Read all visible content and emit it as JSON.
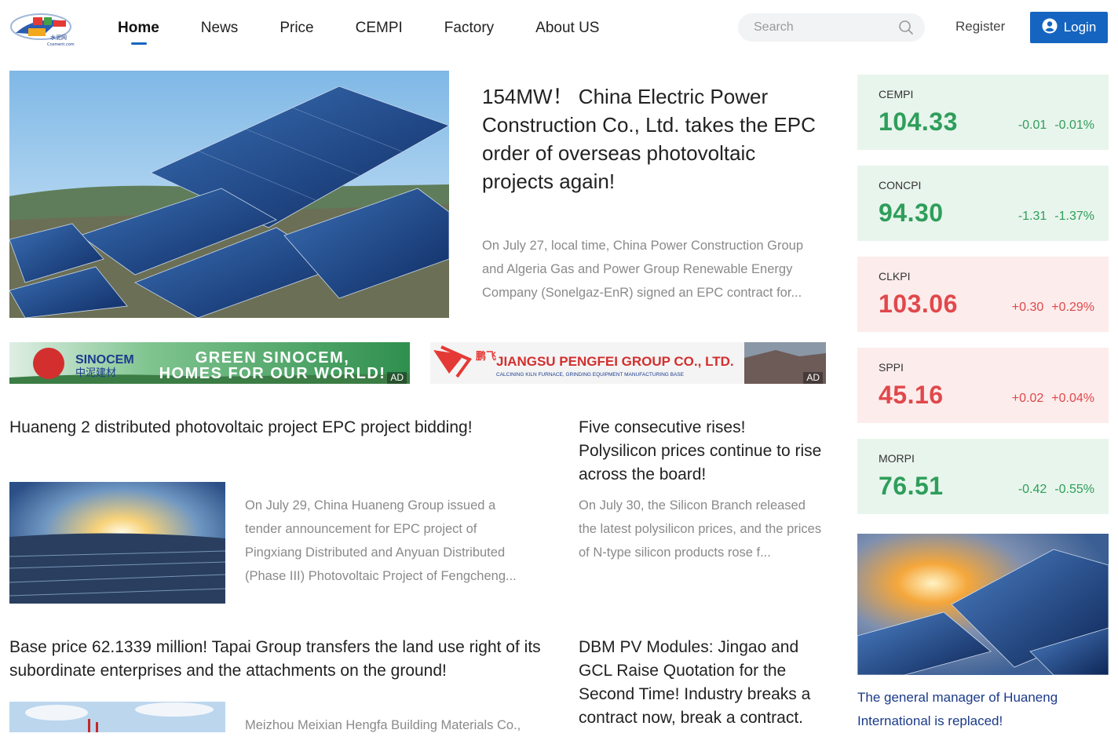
{
  "header": {
    "logo_caption": "水泥网",
    "logo_subcaption": "Ccement.com",
    "nav": [
      "Home",
      "News",
      "Price",
      "CEMPI",
      "Factory",
      "About US"
    ],
    "search_placeholder": "Search",
    "register_label": "Register",
    "login_label": "Login"
  },
  "hero": {
    "title": "154MW！ China Electric Power Construction Co., Ltd. takes the EPC order of overseas photovoltaic projects again!",
    "summary": "On July 27, local time, China Power Construction Group and Algeria Gas and Power Group Renewable Energy Company (Sonelgaz-EnR) signed an EPC contract for..."
  },
  "ads": [
    {
      "brand": "SINOCEM",
      "brand_cn": "中泥建材",
      "line1": "GREEN SINOCEM,",
      "line2": "HOMES FOR OUR WORLD!",
      "tag": "AD"
    },
    {
      "brand_cn": "鹏飞",
      "name": "JIANGSU PENGFEI GROUP CO., LTD.",
      "sub": "CALCINING KILN FURNACE, GRINDING EQUIPMENT MANUFACTURING BASE",
      "tag": "AD"
    }
  ],
  "articles": [
    {
      "title": "Huaneng 2 distributed photovoltaic project EPC project bidding!",
      "summary": "On July 29, China Huaneng Group issued a tender announcement for EPC project of Pingxiang Distributed and Anyuan Distributed (Phase III) Photovoltaic Project of Fengcheng..."
    },
    {
      "title": "Five consecutive rises! Polysilicon prices continue to rise across the board!",
      "summary": "On July 30, the Silicon Branch released the latest polysilicon prices, and the prices of N-type silicon products rose f..."
    },
    {
      "title": "Base price 62.1339 million! Tapai Group transfers the land use right of its subordinate enterprises and the attachments on the ground!",
      "summary": "Meizhou Meixian Hengfa Building Materials Co.,"
    },
    {
      "title": "DBM PV Modules: Jingao and GCL Raise Quotation for the Second Time! Industry breaks a contract now, break a contract."
    }
  ],
  "indices": [
    {
      "name": "CEMPI",
      "value": "104.33",
      "change": "-0.01",
      "percent": "-0.01%",
      "trend": "down"
    },
    {
      "name": "CONCPI",
      "value": "94.30",
      "change": "-1.31",
      "percent": "-1.37%",
      "trend": "down"
    },
    {
      "name": "CLKPI",
      "value": "103.06",
      "change": "+0.30",
      "percent": "+0.29%",
      "trend": "up"
    },
    {
      "name": "SPPI",
      "value": "45.16",
      "change": "+0.02",
      "percent": "+0.04%",
      "trend": "up"
    },
    {
      "name": "MORPI",
      "value": "76.51",
      "change": "-0.42",
      "percent": "-0.55%",
      "trend": "down"
    }
  ],
  "sidebar": {
    "featured_title": "The general manager of Huaneng International is replaced!"
  },
  "colors": {
    "accent": "#1565c0",
    "down": "#2e9e5b",
    "up": "#e0484b",
    "down_bg": "#e8f5ec",
    "up_bg": "#fdecec"
  }
}
